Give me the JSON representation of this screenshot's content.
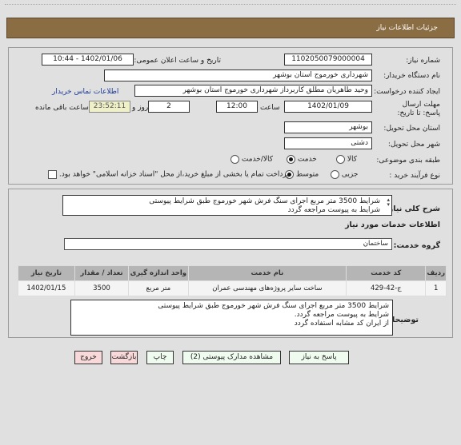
{
  "header": {
    "title": "جزئیات اطلاعات نیاز"
  },
  "details": {
    "need_number": {
      "label": "شماره نیاز:",
      "value": "1102050079000004"
    },
    "announce_datetime": {
      "label": "تاریخ و ساعت اعلان عمومی:",
      "value": "1402/01/06 - 10:44"
    },
    "buyer_org": {
      "label": "نام دستگاه خریدار:",
      "value": "شهرداری خورموج استان بوشهر"
    },
    "requester": {
      "label": "ایجاد کننده درخواست:",
      "value": "وحید طاهریان مطلق کاربرداز شهرداری خورموج استان بوشهر"
    },
    "buyer_contact_link": "اطلاعات تماس خریدار",
    "deadline": {
      "label": "مهلت ارسال پاسخ: تا تاریخ:",
      "date": "1402/01/09",
      "time_label": "ساعت",
      "time": "12:00",
      "days": "2",
      "days_label": "روز و",
      "remaining": "23:52:11",
      "remaining_label": "ساعت باقی مانده"
    },
    "delivery_province": {
      "label": "استان محل تحویل:",
      "value": "بوشهر"
    },
    "delivery_city": {
      "label": "شهر محل تحویل:",
      "value": "دشتی"
    },
    "category": {
      "label": "طبقه بندی موضوعی:",
      "options": [
        {
          "label": "کالا",
          "selected": false
        },
        {
          "label": "خدمت",
          "selected": true
        },
        {
          "label": "کالا/خدمت",
          "selected": false
        }
      ]
    },
    "purchase_type": {
      "label": "نوع فرآیند خرید :",
      "options": [
        {
          "label": "جزیی",
          "selected": false
        },
        {
          "label": "متوسط",
          "selected": true
        }
      ],
      "payment_checkbox_label": "پرداخت تمام یا بخشی از مبلغ خرید،از محل \"اسناد خزانه اسلامی\" خواهد بود.",
      "payment_checked": false
    }
  },
  "general_description": {
    "label": "شرح کلی نیاز:",
    "line1": "شرایط 3500 متر مربع اجرای سنگ فرش شهر خورموج طبق شرایط پیوستی",
    "line2": "شرایط  به پیوست مراجعه گردد"
  },
  "services_section_title": "اطلاعات خدمات مورد نیاز",
  "service_group": {
    "label": "گروه خدمت:",
    "value": "ساختمان"
  },
  "table": {
    "headers": [
      "ردیف",
      "کد خدمت",
      "نام خدمت",
      "واحد اندازه گیری",
      "تعداد / مقدار",
      "تاریخ نیاز"
    ],
    "rows": [
      [
        "1",
        "ج-42-429",
        "ساخت سایر پروژه‌های مهندسی عمران",
        "متر مربع",
        "3500",
        "1402/01/15"
      ]
    ]
  },
  "buyer_notes": {
    "label": "توضیحات خریدار:",
    "line1": "شرایط 3500 متر مربع اجرای سنگ فرش شهر خورموج طبق شرایط پیوستی",
    "line2": "شرایط  به پیوست مراجعه گردد.",
    "line3": "از ایران کد مشابه استفاده گردد"
  },
  "buttons": {
    "reply": "پاسخ به نیاز",
    "attachments": "مشاهده مدارک پیوستی (2)",
    "print": "چاپ",
    "back": "بازگشت",
    "exit": "خروج"
  }
}
